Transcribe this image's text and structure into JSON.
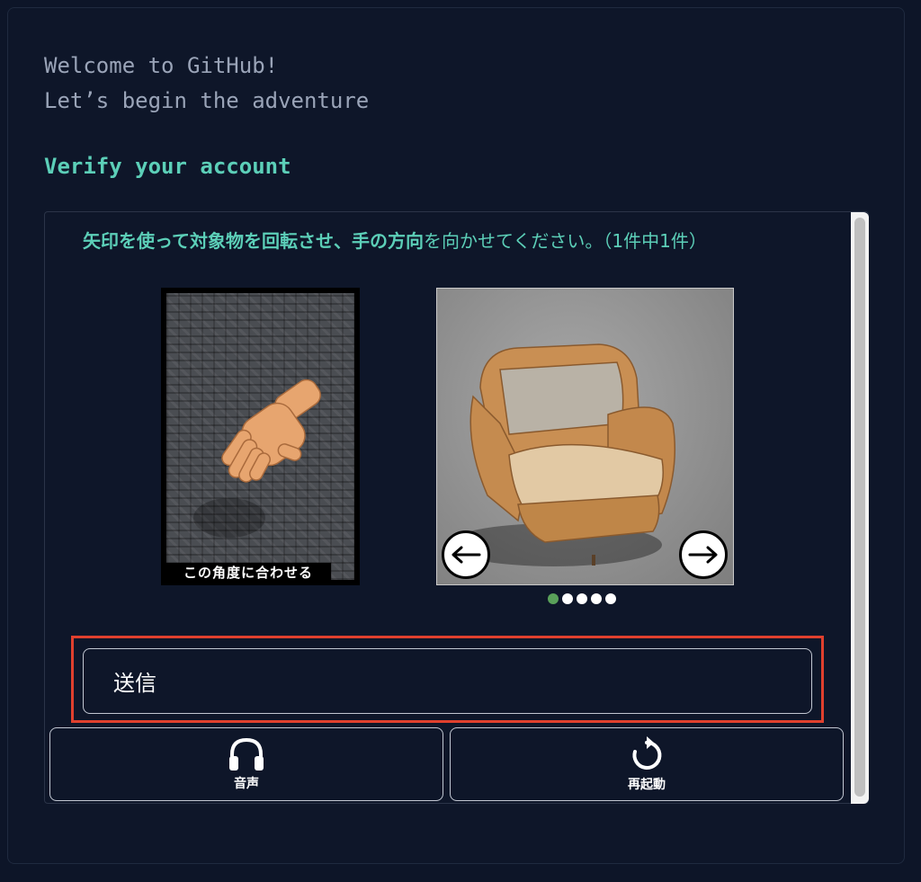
{
  "header": {
    "welcome_line1": "Welcome to GitHub!",
    "welcome_line2": "Let’s begin the adventure",
    "verify_title": "Verify your account"
  },
  "challenge": {
    "instruction_bold": "矢印を使って対象物を回転させ、手の方向",
    "instruction_rest": "を向かせてください。（1件中1件）",
    "reference_caption": "この角度に合わせる",
    "carousel_total": 5,
    "carousel_active": 1
  },
  "actions": {
    "submit_label": "送信",
    "audio_label": "音声",
    "restart_label": "再起動"
  },
  "colors": {
    "accent": "#5ccfb8",
    "highlight": "#e0402e",
    "active_dot": "#5aa15a"
  },
  "icons": {
    "audio": "headphones-icon",
    "restart": "restart-icon",
    "prev": "arrow-left-icon",
    "next": "arrow-right-icon"
  }
}
